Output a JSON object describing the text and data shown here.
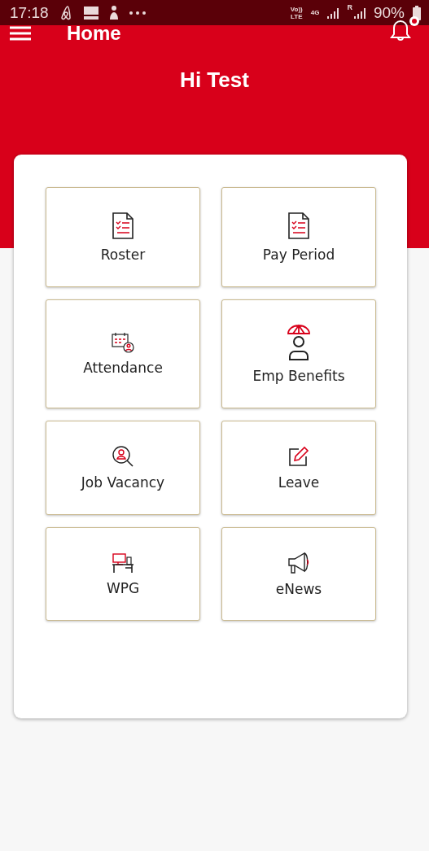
{
  "status_bar": {
    "time": "17:18",
    "network_labels": [
      {
        "kind": "volte",
        "top": "Vo))",
        "bottom": "LTE"
      },
      {
        "kind": "data",
        "top": "4G"
      }
    ],
    "roaming": "R",
    "battery": "90%"
  },
  "header": {
    "title": "Home",
    "notifications": true
  },
  "greeting": "Hi Test",
  "tiles": [
    {
      "label": "Roster",
      "kind": "checklist"
    },
    {
      "label": "Pay Period",
      "kind": "checklist"
    },
    {
      "label": "Attendance",
      "kind": "calendar"
    },
    {
      "label": "Emp Benefits",
      "kind": "umbrella"
    },
    {
      "label": "Job Vacancy",
      "kind": "search-person"
    },
    {
      "label": "Leave",
      "kind": "edit"
    },
    {
      "label": "WPG",
      "kind": "desk"
    },
    {
      "label": "eNews",
      "kind": "megaphone"
    }
  ]
}
